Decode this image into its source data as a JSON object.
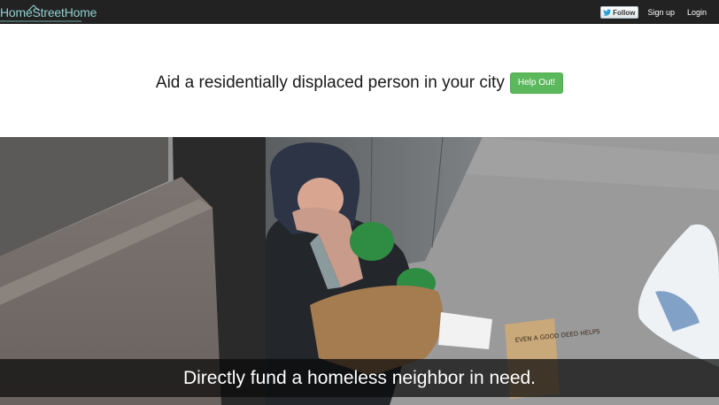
{
  "navbar": {
    "brand": "HomeStreetHome",
    "twitter_follow": "Follow",
    "signup": "Sign up",
    "login": "Login",
    "background": "#222222",
    "brand_color": "#8fd0cf"
  },
  "hero": {
    "heading": "Aid a residentially displaced person in your city",
    "help_button": "Help Out!",
    "button_color": "#5cb85c"
  },
  "photo": {
    "caption": "Directly fund a homeless neighbor in need.",
    "sign_text": "EVEN A GOOD DEED HELPS"
  }
}
